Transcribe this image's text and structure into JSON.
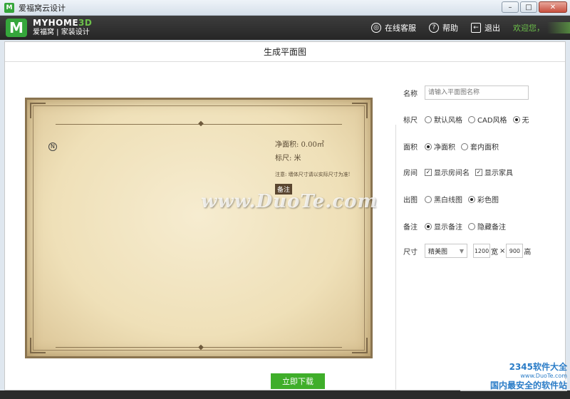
{
  "window": {
    "app_icon": "M",
    "title": "爱福窝云设计",
    "minimize": "–",
    "maximize": "□",
    "close": "✕"
  },
  "header": {
    "logo_mark": "M",
    "brand_my": "MYHOME",
    "brand_3d": "3D",
    "brand_sub": "爱福窝 | 家装设计",
    "nav": {
      "service_label": "在线客服",
      "help_label": "帮助",
      "logout_label": "退出",
      "welcome": "欢迎您，"
    }
  },
  "dialog": {
    "title": "生成平面图"
  },
  "preview": {
    "compass_glyph": "N",
    "net_area": "净面积:  0.00㎡",
    "scale": "标尺:  米",
    "note": "注意: 墙体尺寸请以实际尺寸为准!",
    "remark_tag": "备注",
    "ornament": "◆"
  },
  "form": {
    "name_label": "名称",
    "name_placeholder": "请输入平面图名称",
    "ruler_label": "标尺",
    "ruler_options": [
      "默认风格",
      "CAD风格",
      "无"
    ],
    "ruler_selected": 2,
    "area_label": "面积",
    "area_options": [
      "净面积",
      "套内面积"
    ],
    "area_selected": 0,
    "room_label": "房间",
    "room_options": [
      "显示房间名",
      "显示家具"
    ],
    "output_label": "出图",
    "output_options": [
      "黑白线图",
      "彩色图"
    ],
    "output_selected": 1,
    "remark_label": "备注",
    "remark_options": [
      "显示备注",
      "隐藏备注"
    ],
    "remark_selected": 0,
    "size_label": "尺寸",
    "size_preset": "精美图",
    "width_value": "1200",
    "width_unit": "宽",
    "times": "×",
    "height_value": "900",
    "height_unit": "高"
  },
  "actions": {
    "download_label": "立即下载"
  },
  "watermarks": {
    "center": "www.DuoTe.com",
    "corner_line1": "2345软件大全",
    "corner_line2": "www.DuoTe.com",
    "corner_line3": "国内最安全的软件站"
  }
}
